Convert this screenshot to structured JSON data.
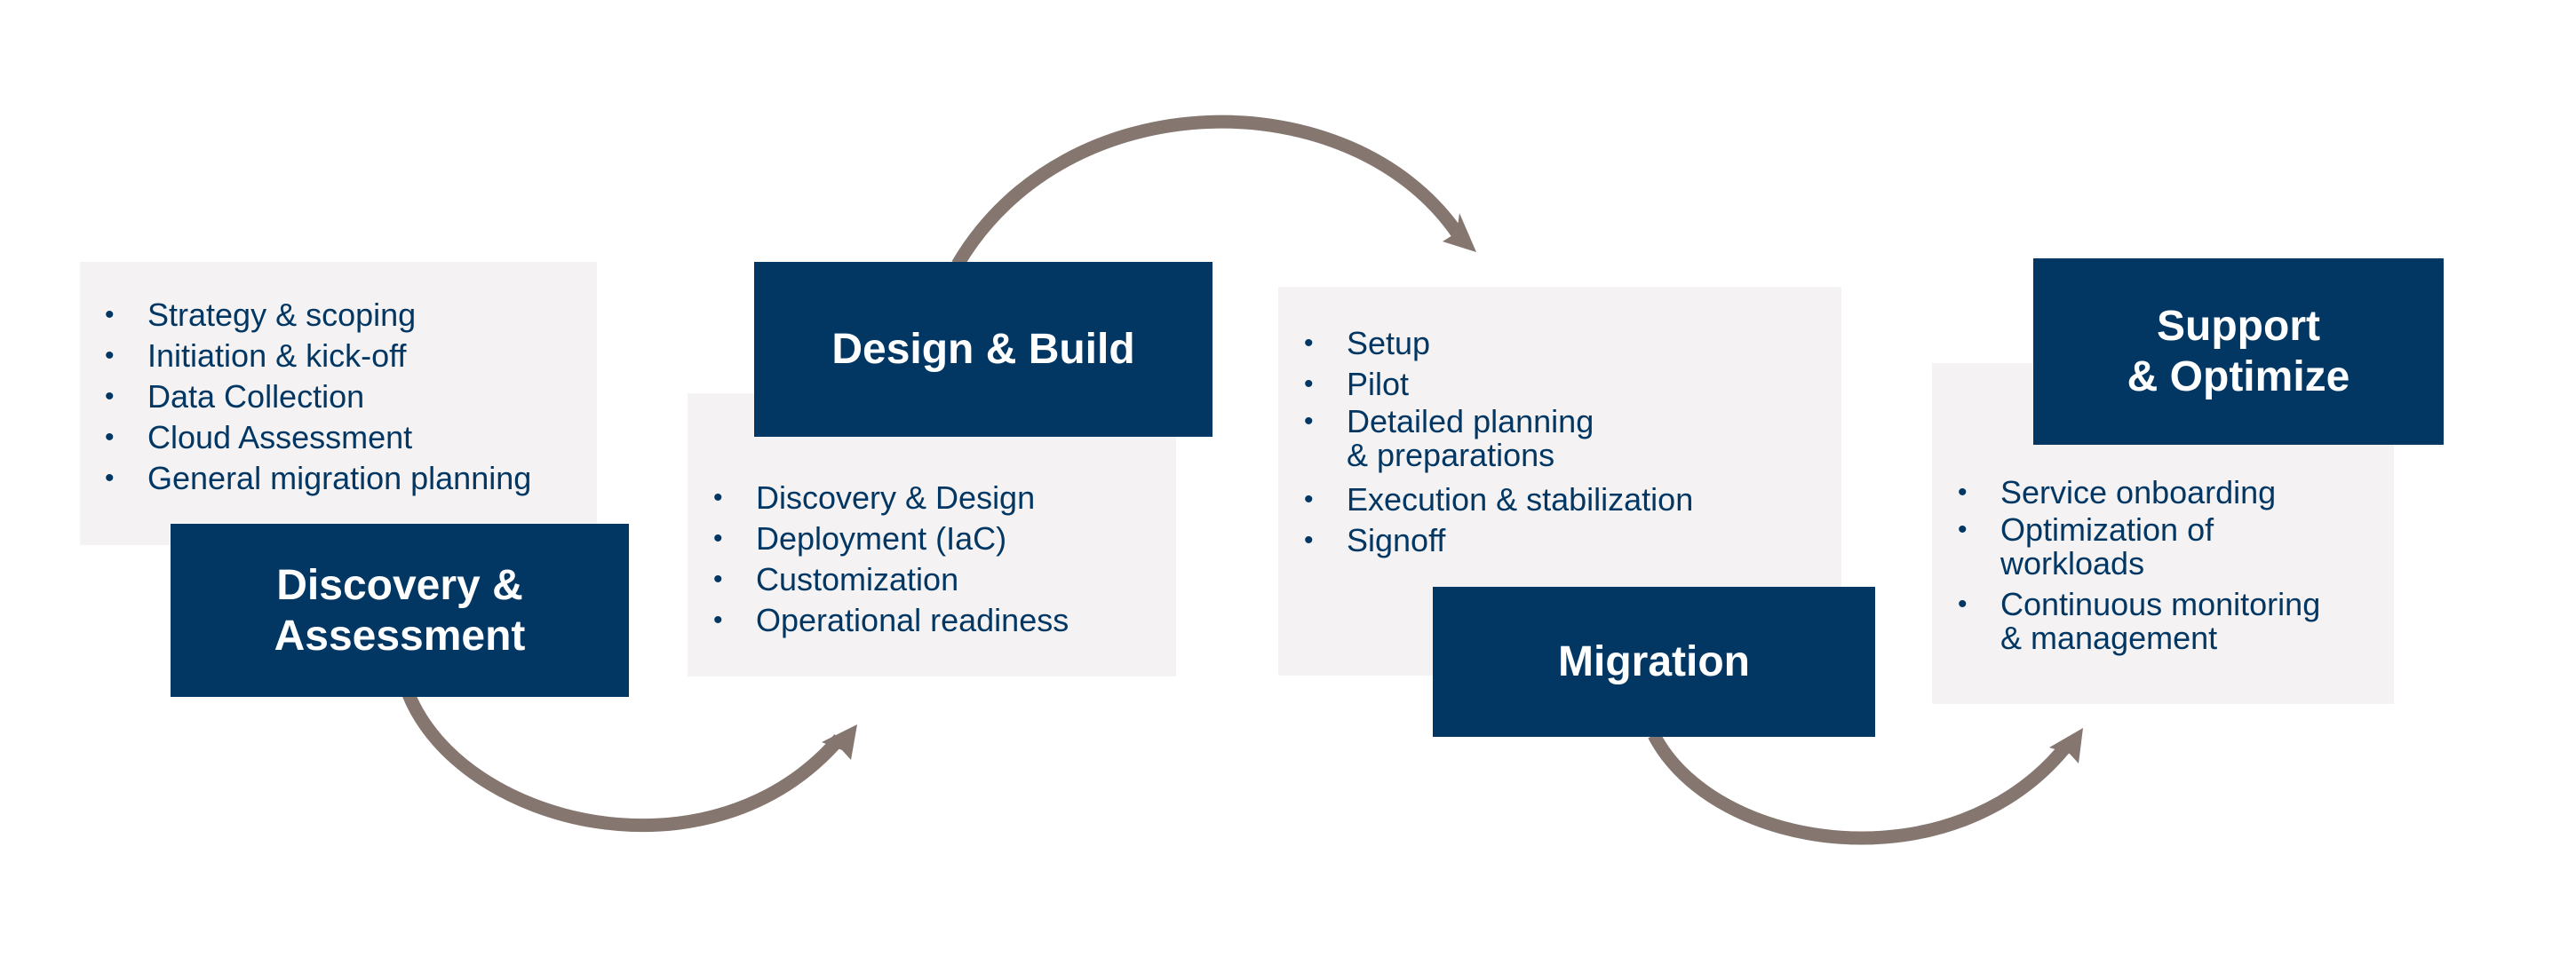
{
  "colors": {
    "title_bg": "#023764",
    "card_bg": "#f4f2f2",
    "text": "#023764",
    "arrow": "#857670"
  },
  "phases": [
    {
      "title": "Discovery &\nAssessment",
      "items": [
        "Strategy & scoping",
        "Initiation & kick-off",
        "Data Collection",
        "Cloud Assessment",
        "General migration planning"
      ]
    },
    {
      "title": "Design & Build",
      "items": [
        "Discovery & Design",
        "Deployment (IaC)",
        "Customization",
        "Operational readiness"
      ]
    },
    {
      "title": "Migration",
      "items": [
        "Setup",
        "Pilot",
        "Detailed planning\n& preparations",
        "Execution & stabilization",
        "Signoff"
      ]
    },
    {
      "title": "Support\n& Optimize",
      "items": [
        "Service onboarding",
        "Optimization of\nworkloads",
        "Continuous monitoring\n& management"
      ]
    }
  ],
  "arrows": [
    {
      "from": "Discovery & Assessment",
      "to": "Design & Build"
    },
    {
      "from": "Design & Build",
      "to": "Migration"
    },
    {
      "from": "Migration",
      "to": "Support & Optimize"
    }
  ]
}
